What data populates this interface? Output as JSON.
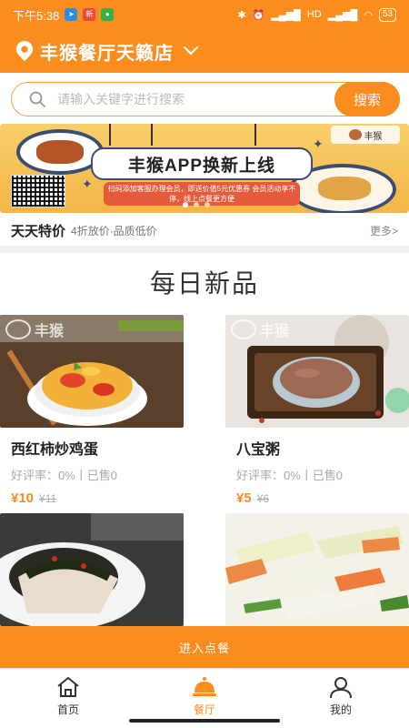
{
  "status_bar": {
    "time": "下午5:38",
    "network": "HD",
    "battery": "53",
    "apps": [
      "telegram-icon",
      "sina-icon",
      "wechat-icon"
    ]
  },
  "header": {
    "store_name": "丰猴餐厅天籁店",
    "icon": "location-pin-icon"
  },
  "search": {
    "placeholder": "请输入关键字进行搜索",
    "button_label": "搜索"
  },
  "banner": {
    "title": "丰猴APP换新上线",
    "subtitle": "扫码添加客服办理会员，即送价值5元优惠券 会员活动享不停，线上点餐更方便",
    "brand": "丰猴",
    "slide_count": 3,
    "active_slide": 0
  },
  "special": {
    "title": "天天特价",
    "desc": "4折放价·品质低价",
    "more": "更多>"
  },
  "section_title": "每日新品",
  "products": [
    {
      "name": "西红柿炒鸡蛋",
      "rating": "好评率：0%丨已售0",
      "price": "¥10",
      "old_price": "¥11"
    },
    {
      "name": "八宝粥",
      "rating": "好评率：0%丨已售0",
      "price": "¥5",
      "old_price": "¥6"
    }
  ],
  "watermark": "丰猴",
  "order_button": "进入点餐",
  "tabs": [
    {
      "label": "首页",
      "icon": "home-icon"
    },
    {
      "label": "餐厅",
      "icon": "restaurant-bell-icon",
      "active": true
    },
    {
      "label": "我的",
      "icon": "user-icon"
    }
  ],
  "colors": {
    "accent": "#fb8c1e",
    "banner": "#f6c65e"
  }
}
